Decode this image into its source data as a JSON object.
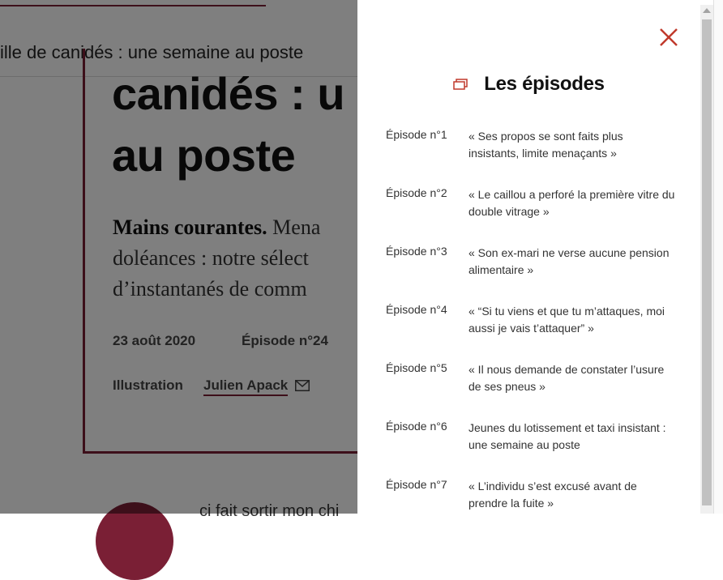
{
  "article": {
    "sticky_title": "ille de canidés : une semaine au poste",
    "title_lines": [
      "canidés : u",
      "au poste"
    ],
    "lead_bold": "Mains courantes.",
    "lead_rest": "Mena",
    "lead_line2": "doléances : notre sélect",
    "lead_line3": "d’instantanés de comm",
    "date": "23 août 2020",
    "episode": "Épisode n°24",
    "credit_label": "Illustration",
    "credit_name": "Julien Apack",
    "below_text": "ci fait sortir mon chi",
    "accent_color": "#7a1f35"
  },
  "panel": {
    "title": "Les épisodes",
    "title_icon": "episodes-icon",
    "close_icon": "close-icon",
    "close_color": "#c0392b",
    "episodes": [
      {
        "num": "Épisode n°1",
        "title": "« Ses propos se sont faits plus insistants, limite menaçants »"
      },
      {
        "num": "Épisode n°2",
        "title": "« Le caillou a perforé la première vitre du double vitrage »"
      },
      {
        "num": "Épisode n°3",
        "title": "« Son ex-mari ne verse aucune pension alimentaire »"
      },
      {
        "num": "Épisode n°4",
        "title": "« “Si tu viens et que tu m’attaques, moi aussi je vais t’attaquer” »"
      },
      {
        "num": "Épisode n°5",
        "title": "« Il nous demande de constater l’usure de ses pneus »"
      },
      {
        "num": "Épisode n°6",
        "title": "Jeunes du lotissement et taxi insistant : une semaine au poste"
      },
      {
        "num": "Épisode n°7",
        "title": "« L’individu s’est excusé avant de prendre la fuite »"
      }
    ]
  }
}
